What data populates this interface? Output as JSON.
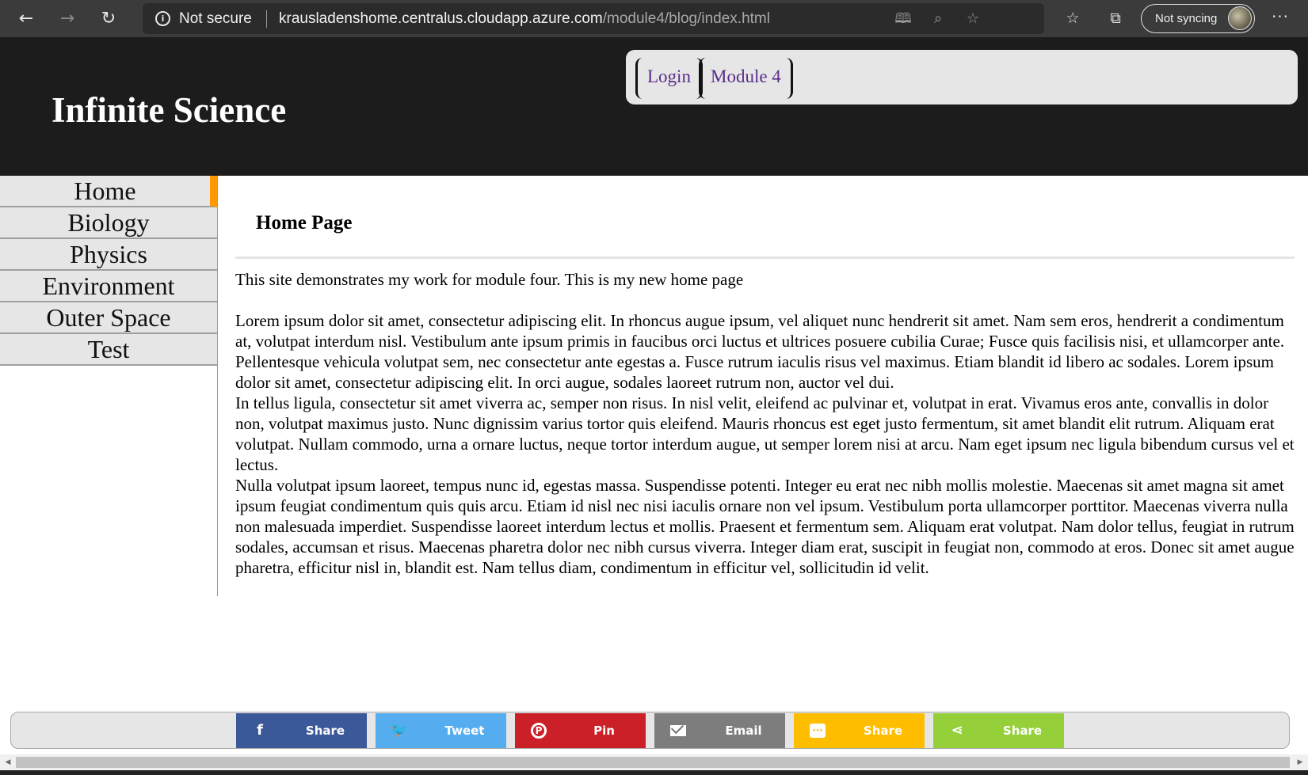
{
  "browser": {
    "back_icon": "arrow-left-icon",
    "forward_icon": "arrow-right-icon",
    "refresh_icon": "refresh-icon",
    "security_label": "Not secure",
    "url_host": "krausladenshome.centralus.cloudapp.azure.com",
    "url_path": "/module4/blog/index.html",
    "sync_label": "Not syncing",
    "more_label": "···"
  },
  "header": {
    "site_title": "Infinite Science",
    "nav_links": [
      {
        "label": "Login"
      },
      {
        "label": "Module 4"
      }
    ]
  },
  "sidebar": {
    "items": [
      {
        "label": "Home",
        "active": true
      },
      {
        "label": "Biology"
      },
      {
        "label": "Physics"
      },
      {
        "label": "Environment"
      },
      {
        "label": "Outer Space"
      },
      {
        "label": "Test"
      }
    ],
    "active_color": "#ff9800"
  },
  "main": {
    "heading": "Home Page",
    "intro": "This site demonstrates my work for module four. This is my new home page",
    "paragraphs": [
      "Lorem ipsum dolor sit amet, consectetur adipiscing elit. In rhoncus augue ipsum, vel aliquet nunc hendrerit sit amet. Nam sem eros, hendrerit a condimentum at, volutpat interdum nisl. Vestibulum ante ipsum primis in faucibus orci luctus et ultrices posuere cubilia Curae; Fusce quis facilisis nisi, et ullamcorper ante. Pellentesque vehicula volutpat sem, nec consectetur ante egestas a. Fusce rutrum iaculis risus vel maximus. Etiam blandit id libero ac sodales. Lorem ipsum dolor sit amet, consectetur adipiscing elit. In orci augue, sodales laoreet rutrum non, auctor vel dui.",
      "In tellus ligula, consectetur sit amet viverra ac, semper non risus. In nisl velit, eleifend ac pulvinar et, volutpat in erat. Vivamus eros ante, convallis in dolor non, volutpat maximus justo. Nunc dignissim varius tortor quis eleifend. Mauris rhoncus est eget justo fermentum, sit amet blandit elit rutrum. Aliquam erat volutpat. Nullam commodo, urna a ornare luctus, neque tortor interdum augue, ut semper lorem nisi at arcu. Nam eget ipsum nec ligula bibendum cursus vel et lectus.",
      "Nulla volutpat ipsum laoreet, tempus nunc id, egestas massa. Suspendisse potenti. Integer eu erat nec nibh mollis molestie. Maecenas sit amet magna sit amet ipsum feugiat condimentum quis quis arcu. Etiam id nisl nec nisi iaculis ornare non vel ipsum. Vestibulum porta ullamcorper porttitor. Maecenas viverra nulla non malesuada imperdiet. Suspendisse laoreet interdum lectus et mollis. Praesent et fermentum sem. Aliquam erat volutpat. Nam dolor tellus, feugiat in rutrum sodales, accumsan et risus. Maecenas pharetra dolor nec nibh cursus viverra. Integer diam erat, suscipit in feugiat non, commodo at eros. Donec sit amet augue pharetra, efficitur nisl in, blandit est. Nam tellus diam, condimentum in efficitur vel, sollicitudin id velit."
    ]
  },
  "share_bar": {
    "buttons": [
      {
        "label": "Share",
        "icon": "facebook-icon",
        "color": "#3b5998"
      },
      {
        "label": "Tweet",
        "icon": "twitter-icon",
        "color": "#55acee"
      },
      {
        "label": "Pin",
        "icon": "pinterest-icon",
        "color": "#cb2027"
      },
      {
        "label": "Email",
        "icon": "email-icon",
        "color": "#7d7d7d"
      },
      {
        "label": "Share",
        "icon": "sms-icon",
        "color": "#ffbd00"
      },
      {
        "label": "Share",
        "icon": "share-icon",
        "color": "#95d03a"
      }
    ]
  }
}
